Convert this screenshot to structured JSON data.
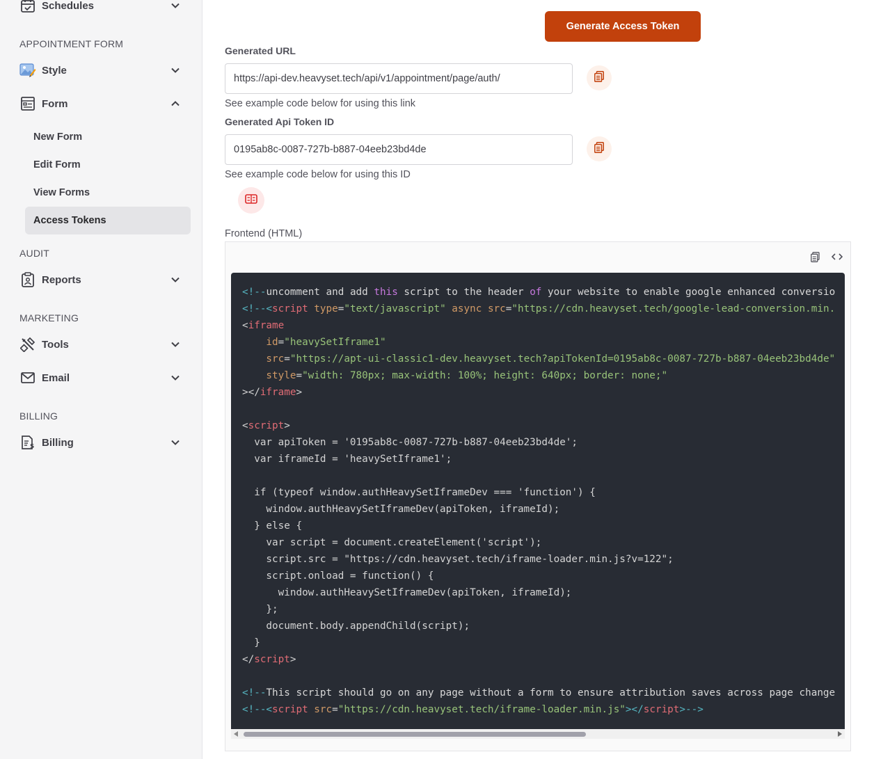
{
  "sidebar": {
    "schedules": "Schedules",
    "section_appointment_form": "APPOINTMENT FORM",
    "style": "Style",
    "form": "Form",
    "form_subitems": [
      "New Form",
      "Edit Form",
      "View Forms",
      "Access Tokens"
    ],
    "active_subitem": "Access Tokens",
    "section_audit": "AUDIT",
    "reports": "Reports",
    "section_marketing": "MARKETING",
    "tools": "Tools",
    "email": "Email",
    "section_billing": "BILLING",
    "billing": "Billing"
  },
  "main": {
    "generate_button": "Generate Access Token",
    "url_label": "Generated URL",
    "url_value": "https://api-dev.heavyset.tech/api/v1/appointment/page/auth/",
    "url_hint": "See example code below for using this link",
    "token_label": "Generated Api Token ID",
    "token_value": "0195ab8c-0087-727b-b887-04eeb23bd4de",
    "token_hint": "See example code below for using this ID",
    "code_heading": "Frontend (HTML)"
  },
  "code": {
    "l1_open": "<!--",
    "l1_a": "uncomment and add ",
    "l1_kw1": "this",
    "l1_b": " script to the header ",
    "l1_kw2": "of",
    "l1_c": " your website to enable google enhanced conversio",
    "l2_open": "<!--<",
    "l2_tag": "script",
    "l2_attr1": " type",
    "l2_eq1": "=",
    "l2_str1": "\"text/javascript\"",
    "l2_attr2": " async src",
    "l2_eq2": "=",
    "l2_str2": "\"https://cdn.heavyset.tech/google-lead-conversion.min.",
    "l3_lt": "<",
    "l3_tag": "iframe",
    "l4_attr": "    id",
    "l4_eq": "=",
    "l4_str": "\"heavySetIframe1\"",
    "l5_attr": "    src",
    "l5_eq": "=",
    "l5_str": "\"https://apt-ui-classic1-dev.heavyset.tech?apiTokenId=0195ab8c-0087-727b-b887-04eeb23bd4de\"",
    "l6_attr": "    style",
    "l6_eq": "=",
    "l6_str": "\"width: 780px; max-width: 100%; height: 640px; border: none;\"",
    "l7_a": "></",
    "l7_tag": "iframe",
    "l7_b": ">",
    "l9_lt": "<",
    "l9_tag": "script",
    "l9_gt": ">",
    "l10": "  var apiToken = '0195ab8c-0087-727b-b887-04eeb23bd4de';",
    "l11": "  var iframeId = 'heavySetIframe1';",
    "l13": "  if (typeof window.authHeavySetIframeDev === 'function') {",
    "l14": "    window.authHeavySetIframeDev(apiToken, iframeId);",
    "l15": "  } else {",
    "l16": "    var script = document.createElement('script');",
    "l17": "    script.src = \"https://cdn.heavyset.tech/iframe-loader.min.js?v=122\";",
    "l18": "    script.onload = function() {",
    "l19": "      window.authHeavySetIframeDev(apiToken, iframeId);",
    "l20": "    };",
    "l21": "    document.body.appendChild(script);",
    "l22": "  }",
    "l23_lt": "</",
    "l23_tag": "script",
    "l23_gt": ">",
    "l25_open": "<!--",
    "l25_text": "This script should go on any page without a form to ensure attribution saves across page change",
    "l26_open": "<!--<",
    "l26_tag": "script",
    "l26_attr": " src",
    "l26_eq": "=",
    "l26_str": "\"https://cdn.heavyset.tech/iframe-loader.min.js\"",
    "l26_mid": "></",
    "l26_tag2": "script",
    "l26_close": ">-->"
  },
  "colors": {
    "accent": "#c2410c",
    "code_bg": "#282c34",
    "sidebar_bg": "#f5f5f6"
  }
}
